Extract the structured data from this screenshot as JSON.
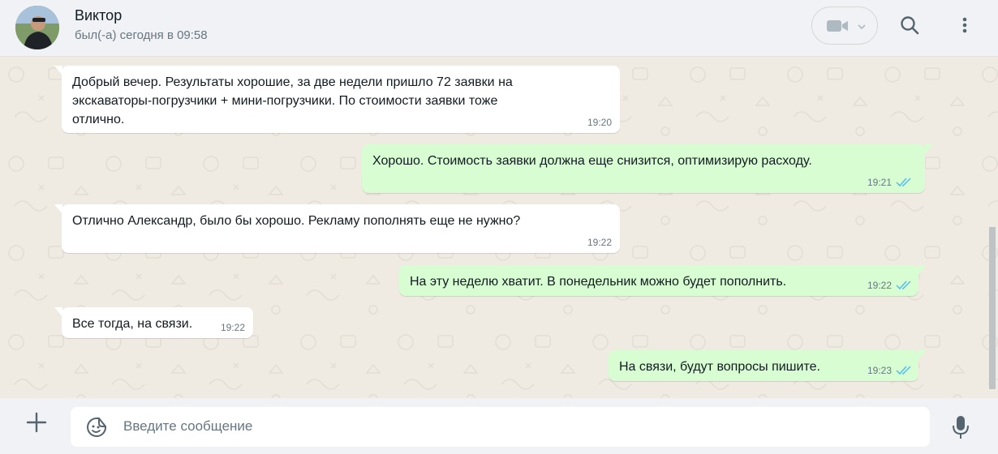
{
  "header": {
    "contact_name": "Виктор",
    "last_seen": "был(-а) сегодня в 09:58",
    "icons": [
      "avatar",
      "video-call-icon",
      "chevron-down-icon",
      "search-icon",
      "menu-dots-icon"
    ]
  },
  "messages": [
    {
      "direction": "in",
      "lines": [
        "Добрый вечер. Результаты хорошие, за две недели пришло 72 заявки на",
        "экскаваторы-погрузчики + мини-погрузчики. По стоимости заявки тоже",
        "отлично."
      ],
      "time": "19:20"
    },
    {
      "direction": "out",
      "lines": [
        "Хорошо. Стоимость заявки должна еще снизится, оптимизирую расходу."
      ],
      "time": "19:21",
      "status": "read"
    },
    {
      "direction": "in",
      "lines": [
        "Отлично Александр, было бы хорошо. Рекламу пополнять еще не нужно?"
      ],
      "time": "19:22"
    },
    {
      "direction": "out",
      "lines": [
        "На эту неделю хватит. В понедельник можно будет пополнить."
      ],
      "time": "19:22",
      "status": "read"
    },
    {
      "direction": "in",
      "lines": [
        "Все тогда, на связи."
      ],
      "time": "19:22"
    },
    {
      "direction": "out",
      "lines": [
        "На связи, будут вопросы пишите."
      ],
      "time": "19:23",
      "status": "read"
    }
  ],
  "composer": {
    "placeholder": "Введите сообщение",
    "icons": [
      "plus-icon",
      "sticker-icon",
      "microphone-icon"
    ]
  },
  "colors": {
    "chat_background": "#efeae2",
    "incoming_bubble": "#ffffff",
    "outgoing_bubble": "#d9fdd3",
    "read_ticks": "#53bdeb",
    "panel": "#f0f2f5"
  }
}
